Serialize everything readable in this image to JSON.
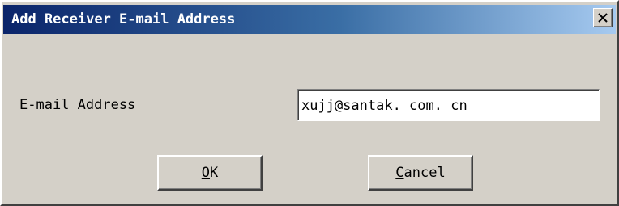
{
  "dialog": {
    "title": "Add Receiver E-mail Address",
    "close_glyph": "✕",
    "field_label": "E-mail Address",
    "email_value": "xujj@santak. com. cn",
    "ok": {
      "mnemonic": "O",
      "rest": "K"
    },
    "cancel": {
      "mnemonic": "C",
      "rest": "ancel"
    }
  },
  "colors": {
    "dialog_face": "#d4d0c8",
    "title_gradient_start": "#0a246a",
    "title_gradient_end": "#a6caf0",
    "title_text": "#ffffff"
  },
  "icons": {
    "close": "close-icon"
  }
}
